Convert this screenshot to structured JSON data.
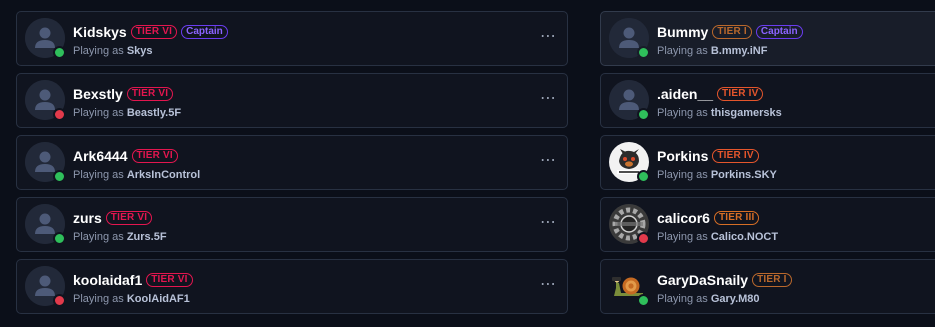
{
  "playing_as_label": "Playing as",
  "more_label": "⋯",
  "tier_colors": {
    "TIER VI": "#e3164f",
    "TIER IV": "#e5562c",
    "TIER III": "#d66e25",
    "TIER I": "#b9682c"
  },
  "left_team": [
    {
      "name": "Kidskys",
      "tier": "TIER VI",
      "captain": "Captain",
      "gamertag": "Skys",
      "status": "online",
      "avatar": "default-avatar-icon"
    },
    {
      "name": "Bexstly",
      "tier": "TIER VI",
      "captain": null,
      "gamertag": "Beastly.5F",
      "status": "offline",
      "avatar": "default-avatar-icon"
    },
    {
      "name": "Ark6444",
      "tier": "TIER VI",
      "captain": null,
      "gamertag": "ArksInControl",
      "status": "online",
      "avatar": "default-avatar-icon"
    },
    {
      "name": "zurs",
      "tier": "TIER VI",
      "captain": null,
      "gamertag": "Zurs.5F",
      "status": "online",
      "avatar": "default-avatar-icon"
    },
    {
      "name": "koolaidaf1",
      "tier": "TIER VI",
      "captain": null,
      "gamertag": "KoolAidAF1",
      "status": "offline",
      "avatar": "default-avatar-icon"
    }
  ],
  "right_team": [
    {
      "name": "Bummy",
      "tier": "TIER I",
      "captain": "Captain",
      "gamertag": "B.mmy.iNF",
      "status": "online",
      "avatar": "default-avatar-icon",
      "highlight": true
    },
    {
      "name": ".aiden__",
      "tier": "TIER IV",
      "captain": null,
      "gamertag": "thisgamersks",
      "status": "online",
      "avatar": "default-avatar-icon"
    },
    {
      "name": "Porkins",
      "tier": "TIER IV",
      "captain": null,
      "gamertag": "Porkins.SKY",
      "status": "online",
      "avatar": "pig-logo-icon"
    },
    {
      "name": "calicor6",
      "tier": "TIER III",
      "captain": null,
      "gamertag": "Calico.NOCT",
      "status": "offline",
      "avatar": "gear-logo-icon"
    },
    {
      "name": "GaryDaSnaily",
      "tier": "TIER I",
      "captain": null,
      "gamertag": "Gary.M80",
      "status": "online",
      "avatar": "snail-icon"
    }
  ]
}
